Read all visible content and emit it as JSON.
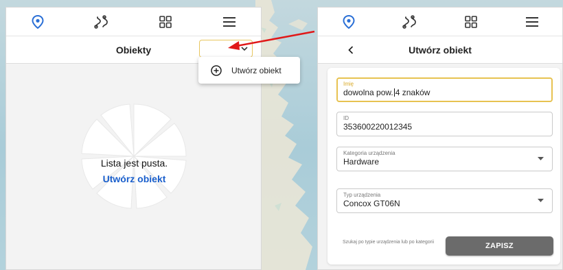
{
  "colors": {
    "accent_blue": "#2a6fd6",
    "focus_yellow": "#e7c250",
    "link_blue": "#1a5fcc",
    "annotation_red": "#e01818",
    "button_gray": "#6b6b6b"
  },
  "nav": {
    "items": [
      {
        "icon": "location-pin-icon",
        "active": true
      },
      {
        "icon": "route-icon",
        "active": false
      },
      {
        "icon": "grid-icon",
        "active": false
      },
      {
        "icon": "hamburger-menu-icon",
        "active": false
      }
    ]
  },
  "left_panel": {
    "title": "Obiekty",
    "empty_title": "Lista jest pusta.",
    "empty_link": "Utwórz obiekt",
    "menu": {
      "item_icon": "add-circle-icon",
      "item_label": "Utwórz obiekt"
    }
  },
  "right_panel": {
    "title": "Utwórz obiekt",
    "form": {
      "name": {
        "label": "Imię",
        "value_before_caret": "dowolna pow.",
        "value_after_caret": "4 znaków"
      },
      "id": {
        "label": "ID",
        "value": "353600220012345"
      },
      "category": {
        "label": "Kategoria urządzenia",
        "value": "Hardware"
      },
      "helper": "Szukaj po typie urządzenia lub po kategorii",
      "device_type": {
        "label": "Typ urządzenia",
        "value": "Concox GT06N"
      },
      "save_label": "ZAPISZ"
    }
  }
}
